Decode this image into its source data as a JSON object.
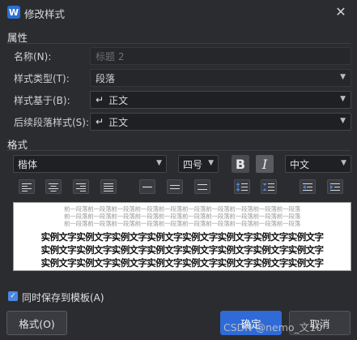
{
  "window": {
    "title": "修改样式",
    "app_icon_letter": "W",
    "close_glyph": "✕"
  },
  "properties": {
    "section_label": "属性",
    "name_label": "名称(N):",
    "name_value": "标题 2",
    "style_type_label": "样式类型(T):",
    "style_type_value": "段落",
    "based_on_label": "样式基于(B):",
    "based_on_value": "正文",
    "next_style_label": "后续段落样式(S):",
    "next_style_value": "正文",
    "paragraph_mark_glyph": "↵"
  },
  "format": {
    "section_label": "格式",
    "font_value": "楷体",
    "size_value": "四号",
    "bold_label": "B",
    "italic_label": "I",
    "language_value": "中文"
  },
  "preview": {
    "prev_paragraph_text": "前一段落前一段落前一段落前一段落前一段落前一段落前一段落前一段落前一段落前一段落",
    "sample_text": "实例文字实例文字实例文字实例文字实例文字实例文字实例文字实例文字"
  },
  "options": {
    "save_to_template_label": "同时保存到模板(A)",
    "save_to_template_checked": true
  },
  "buttons": {
    "format_label": "格式(O)",
    "ok_label": "确定",
    "cancel_label": "取消"
  },
  "watermark": "CSDN @nemo_文10",
  "colors": {
    "background": "#2b2c30",
    "accent": "#2f6ad6",
    "checkbox": "#4a88e0"
  },
  "icons": [
    "close-icon",
    "app-icon",
    "dropdown-arrow-icon",
    "return-arrow-icon",
    "align-left-icon",
    "align-center-icon",
    "align-right-icon",
    "justify-icon",
    "line-spacing-icon",
    "indent-icon",
    "check-icon"
  ]
}
